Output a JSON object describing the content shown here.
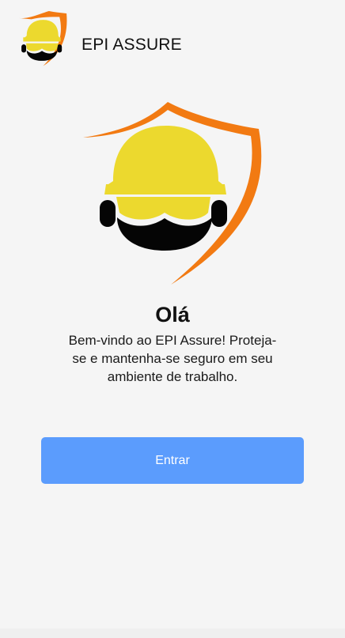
{
  "header": {
    "logo_icon": "hardhat-shield-icon",
    "title": "EPI ASSURE"
  },
  "hero": {
    "logo_icon": "hardhat-shield-icon"
  },
  "main": {
    "greeting": "Olá",
    "welcome_text": "Bem-vindo ao EPI Assure! Proteja-se e mantenha-se seguro em seu ambiente de trabalho."
  },
  "actions": {
    "enter_label": "Entrar"
  },
  "colors": {
    "background": "#f5f5f5",
    "accent_blue": "#5b9cfd",
    "helmet_yellow": "#ecd92e",
    "shield_orange": "#f27a12",
    "dark": "#050505"
  }
}
